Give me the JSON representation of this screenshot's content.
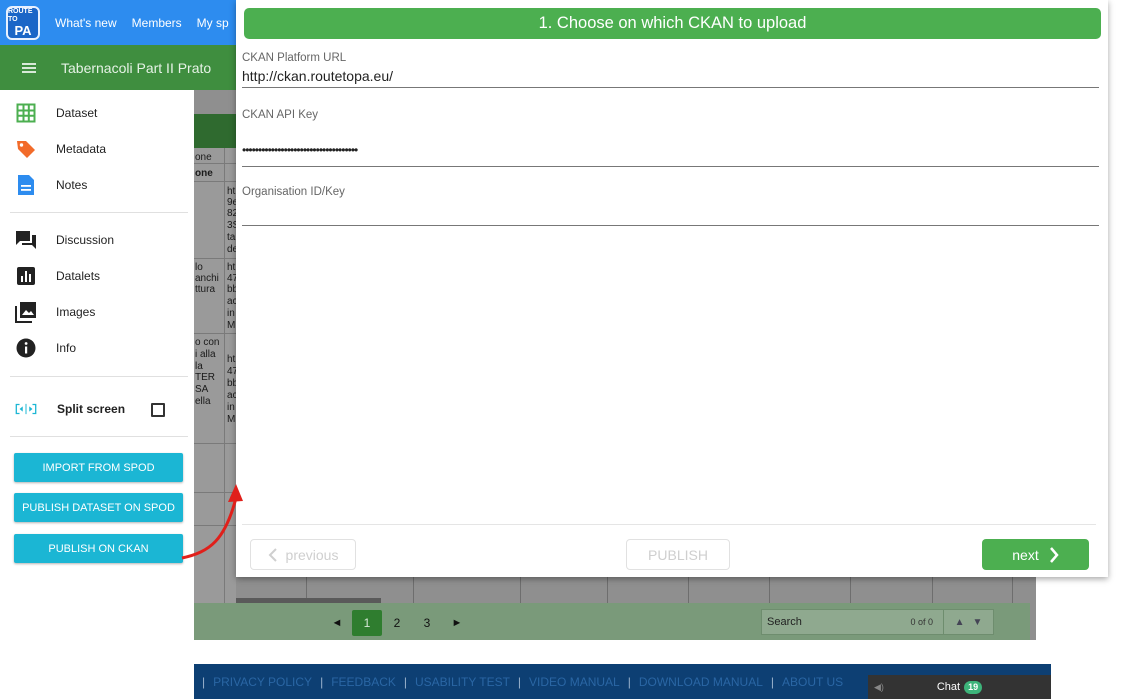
{
  "topnav": {
    "logo": {
      "line1": "ROUTE TO",
      "line2": "PA"
    },
    "links": [
      "What's new",
      "Members",
      "My sp"
    ]
  },
  "header": {
    "title": "Tabernacoli Part II Prato"
  },
  "sidebar": {
    "items": [
      {
        "label": "Dataset",
        "icon": "grid-icon"
      },
      {
        "label": "Metadata",
        "icon": "tag-icon"
      },
      {
        "label": "Notes",
        "icon": "document-icon"
      },
      {
        "label": "Discussion",
        "icon": "chat-icon"
      },
      {
        "label": "Datalets",
        "icon": "bar-chart-icon"
      },
      {
        "label": "Images",
        "icon": "images-icon"
      },
      {
        "label": "Info",
        "icon": "info-icon"
      }
    ],
    "split_screen": {
      "label": "Split screen",
      "checked": false
    },
    "buttons": {
      "import_spod": "IMPORT FROM SPOD",
      "publish_spod": "PUBLISH DATASET ON SPOD",
      "publish_ckan": "PUBLISH ON CKAN"
    }
  },
  "background_table": {
    "header_cells": [
      "one",
      "one"
    ],
    "cells": [
      [
        "ht",
        "9e",
        "82",
        "3S",
        "ta",
        "de"
      ],
      [
        "lo",
        "anchi",
        "ttura"
      ],
      [
        "ht",
        "47",
        "bb",
        "ac",
        "in",
        "M"
      ],
      [
        "o con",
        "i alla",
        "la",
        "TER",
        "SA",
        "ella"
      ],
      [
        "ht",
        "47",
        "bb",
        "ac",
        "in",
        "M"
      ]
    ]
  },
  "pager": {
    "pages": [
      "1",
      "2",
      "3"
    ],
    "current": "1",
    "prev": "◄",
    "next": "►"
  },
  "table_search": {
    "placeholder": "Search",
    "count": "0 of 0"
  },
  "footer": {
    "links": [
      "PRIVACY POLICY",
      "FEEDBACK",
      "USABILITY TEST",
      "VIDEO MANUAL",
      "DOWNLOAD MANUAL",
      "ABOUT US"
    ]
  },
  "chat": {
    "label": "Chat",
    "count": "19"
  },
  "modal": {
    "title": "1. Choose on which CKAN to upload",
    "fields": {
      "platform_url": {
        "label": "CKAN Platform URL",
        "value": "http://ckan.routetopa.eu/"
      },
      "api_key": {
        "label": "CKAN API Key",
        "value": "••••••••••••••••••••••••••••••••••••"
      },
      "org_id": {
        "label": "Organisation ID/Key",
        "value": ""
      }
    },
    "buttons": {
      "previous": "previous",
      "publish": "PUBLISH",
      "next": "next"
    }
  },
  "colors": {
    "nav_blue": "#2d8cef",
    "header_green": "#3f8e3f",
    "modal_green": "#4caf50",
    "cyan_button": "#1bb6d4",
    "footer_navy": "#0d3f73",
    "arrow_red": "#e0201b"
  }
}
